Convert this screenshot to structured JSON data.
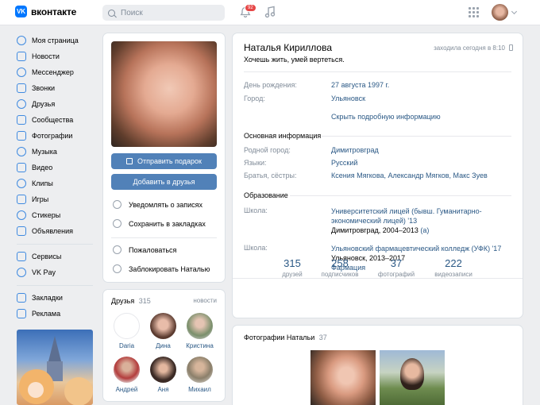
{
  "header": {
    "logo_mark": "VK",
    "logo_text": "вконтакте",
    "search_placeholder": "Поиск",
    "notifications_count": "92"
  },
  "sidebar": {
    "items": [
      {
        "label": "Моя страница"
      },
      {
        "label": "Новости"
      },
      {
        "label": "Мессенджер"
      },
      {
        "label": "Звонки"
      },
      {
        "label": "Друзья"
      },
      {
        "label": "Сообщества"
      },
      {
        "label": "Фотографии"
      },
      {
        "label": "Музыка"
      },
      {
        "label": "Видео"
      },
      {
        "label": "Клипы"
      },
      {
        "label": "Игры"
      },
      {
        "label": "Стикеры"
      },
      {
        "label": "Объявления"
      }
    ],
    "items2": [
      {
        "label": "Сервисы"
      },
      {
        "label": "VK Pay"
      }
    ],
    "items3": [
      {
        "label": "Закладки"
      },
      {
        "label": "Реклама"
      }
    ]
  },
  "left": {
    "gift_button": "Отправить подарок",
    "add_friend_button": "Добавить в друзья",
    "notify": "Уведомлять о записях",
    "bookmark": "Сохранить в закладках",
    "report": "Пожаловаться",
    "block": "Заблокировать Наталью",
    "friends_title": "Друзья",
    "friends_count": "315",
    "friends_news": "новости",
    "friends": [
      {
        "name": "Daria"
      },
      {
        "name": "Дина"
      },
      {
        "name": "Кристина"
      },
      {
        "name": "Андрей"
      },
      {
        "name": "Аня"
      },
      {
        "name": "Михаил"
      }
    ]
  },
  "profile": {
    "name": "Наталья Кириллова",
    "status": "Хочешь жить, умей вертеться.",
    "last_seen": "заходила сегодня в 8:10",
    "birthday_label": "День рождения:",
    "birthday": "27 августа 1997 г.",
    "city_label": "Город:",
    "city": "Ульяновск",
    "show_more": "Скрыть подробную информацию",
    "main_info": "Основная информация",
    "hometown_label": "Родной город:",
    "hometown": "Димитровград",
    "langs_label": "Языки:",
    "langs": "Русский",
    "siblings_label": "Братья, сёстры:",
    "siblings": "Ксения Мягкова, Александр Мягков, Макс Зуев",
    "education": "Образование",
    "school_label": "Школа:",
    "school1_line1": "Университетский лицей (бывш. Гуманитарно-",
    "school1_line2": "экономический лицей) '13",
    "school1_city": "Димитровград, 2004–2013",
    "school1_tag": "(а)",
    "school2_line1": "Ульяновский фармацевтический колледж (УФК) '17",
    "school2_city": "Ульяновск, 2013–2017",
    "school2_spec": "Фармация"
  },
  "stats": [
    {
      "n": "315",
      "l": "друзей"
    },
    {
      "n": "258",
      "l": "подписчиков"
    },
    {
      "n": "37",
      "l": "фотографий"
    },
    {
      "n": "222",
      "l": "видеозаписи"
    }
  ],
  "photos": {
    "title": "Фотографии Натальи",
    "count": "37"
  }
}
